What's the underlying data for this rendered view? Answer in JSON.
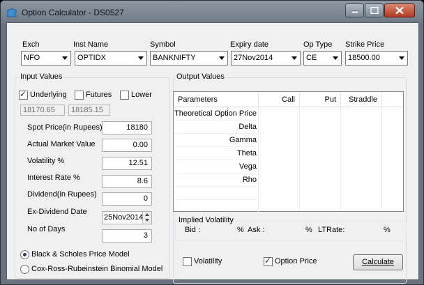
{
  "window": {
    "title": "Option Calculator - DS0527",
    "icon": "puzzle-icon",
    "controls": [
      "minimize-icon",
      "maximize-icon",
      "close-icon"
    ]
  },
  "selectors": {
    "exch": {
      "label": "Exch",
      "value": "NFO"
    },
    "inst_name": {
      "label": "Inst Name",
      "value": "OPTIDX"
    },
    "symbol": {
      "label": "Symbol",
      "value": "BANKNIFTY"
    },
    "expiry_date": {
      "label": "Expiry date",
      "value": "27Nov2014"
    },
    "op_type": {
      "label": "Op Type",
      "value": "CE"
    },
    "strike_price": {
      "label": "Strike Price",
      "value": "18500.00"
    }
  },
  "input_values": {
    "title": "Input Values",
    "underlying": {
      "label": "Underlying",
      "checked": true
    },
    "futures": {
      "label": "Futures",
      "checked": false
    },
    "lower": {
      "label": "Lower",
      "checked": false
    },
    "price_a": "18170.65",
    "price_b": "18185.15",
    "fields": {
      "spot_price": {
        "label": "Spot Price(in Rupees)",
        "value": "18180"
      },
      "actual_market_value": {
        "label": "Actual Market Value",
        "value": "0.00"
      },
      "volatility": {
        "label": "Volatility %",
        "value": "12.51"
      },
      "interest_rate": {
        "label": "Interest Rate %",
        "value": "8.6"
      },
      "dividend": {
        "label": "Dividend(in Rupees)",
        "value": "0"
      },
      "ex_dividend_date": {
        "label": "Ex-Dividend Date",
        "value": "25Nov2014"
      },
      "no_of_days": {
        "label": "No of Days",
        "value": "3"
      }
    },
    "models": {
      "black_scholes": {
        "label": "Black & Scholes Price Model",
        "selected": true
      },
      "crr": {
        "label": "Cox-Ross-Rubeinstein Binomial Model",
        "selected": false
      }
    }
  },
  "output_values": {
    "title": "Output Values",
    "columns": [
      "Parameters",
      "Call",
      "Put",
      "Straddle"
    ],
    "rows": [
      "Theoretical Option Price",
      "Delta",
      "Gamma",
      "Theta",
      "Vega",
      "Rho"
    ]
  },
  "implied_volatility": {
    "title": "Implied Volatility",
    "bid_label": "Bid :",
    "bid_unit": "%",
    "ask_label": "Ask :",
    "ask_unit": "%",
    "ltrate_label": "LTRate:",
    "ltrate_unit": "%"
  },
  "bottom": {
    "volatility": {
      "label": "Volatility",
      "checked": false
    },
    "option_price": {
      "label": "Option Price",
      "checked": true
    },
    "calculate": "Calculate"
  }
}
